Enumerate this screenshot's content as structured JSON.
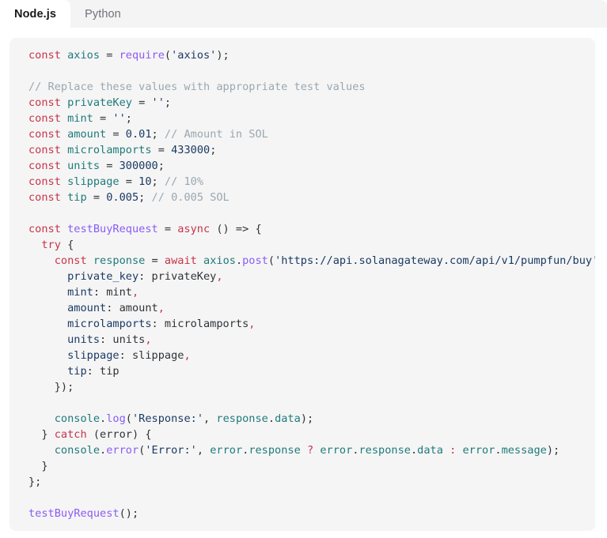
{
  "tabs": [
    {
      "id": "nodejs",
      "label": "Node.js",
      "active": true
    },
    {
      "id": "python",
      "label": "Python",
      "active": false
    }
  ],
  "colors": {
    "tabbar_bg": "#f4f4f5",
    "tab_active_bg": "#ffffff",
    "tab_active_text": "#18181b",
    "tab_inactive_text": "#71717a",
    "code_bg": "#f5f5f5",
    "keyword": "#c7344a",
    "identifier": "#1f7a7a",
    "function": "#8a5cf6",
    "string": "#1b3a63",
    "number": "#1b3a63",
    "comment": "#9aa7b0",
    "plain": "#2f3337"
  },
  "code": {
    "language": "javascript",
    "lines": [
      [
        {
          "t": "const",
          "c": "keyword"
        },
        {
          "t": " ",
          "c": "plain"
        },
        {
          "t": "axios",
          "c": "ident"
        },
        {
          "t": " = ",
          "c": "op"
        },
        {
          "t": "require",
          "c": "func"
        },
        {
          "t": "(",
          "c": "punct"
        },
        {
          "t": "'axios'",
          "c": "string"
        },
        {
          "t": ");",
          "c": "punct"
        }
      ],
      [],
      [
        {
          "t": "// Replace these values with appropriate test values",
          "c": "comment"
        }
      ],
      [
        {
          "t": "const",
          "c": "keyword"
        },
        {
          "t": " ",
          "c": "plain"
        },
        {
          "t": "privateKey",
          "c": "ident"
        },
        {
          "t": " = ",
          "c": "op"
        },
        {
          "t": "''",
          "c": "string"
        },
        {
          "t": ";",
          "c": "punct"
        }
      ],
      [
        {
          "t": "const",
          "c": "keyword"
        },
        {
          "t": " ",
          "c": "plain"
        },
        {
          "t": "mint",
          "c": "ident"
        },
        {
          "t": " = ",
          "c": "op"
        },
        {
          "t": "''",
          "c": "string"
        },
        {
          "t": ";",
          "c": "punct"
        }
      ],
      [
        {
          "t": "const",
          "c": "keyword"
        },
        {
          "t": " ",
          "c": "plain"
        },
        {
          "t": "amount",
          "c": "ident"
        },
        {
          "t": " = ",
          "c": "op"
        },
        {
          "t": "0.01",
          "c": "number"
        },
        {
          "t": "; ",
          "c": "punct"
        },
        {
          "t": "// Amount in SOL",
          "c": "comment"
        }
      ],
      [
        {
          "t": "const",
          "c": "keyword"
        },
        {
          "t": " ",
          "c": "plain"
        },
        {
          "t": "microlamports",
          "c": "ident"
        },
        {
          "t": " = ",
          "c": "op"
        },
        {
          "t": "433000",
          "c": "number"
        },
        {
          "t": ";",
          "c": "punct"
        }
      ],
      [
        {
          "t": "const",
          "c": "keyword"
        },
        {
          "t": " ",
          "c": "plain"
        },
        {
          "t": "units",
          "c": "ident"
        },
        {
          "t": " = ",
          "c": "op"
        },
        {
          "t": "300000",
          "c": "number"
        },
        {
          "t": ";",
          "c": "punct"
        }
      ],
      [
        {
          "t": "const",
          "c": "keyword"
        },
        {
          "t": " ",
          "c": "plain"
        },
        {
          "t": "slippage",
          "c": "ident"
        },
        {
          "t": " = ",
          "c": "op"
        },
        {
          "t": "10",
          "c": "number"
        },
        {
          "t": "; ",
          "c": "punct"
        },
        {
          "t": "// 10%",
          "c": "comment"
        }
      ],
      [
        {
          "t": "const",
          "c": "keyword"
        },
        {
          "t": " ",
          "c": "plain"
        },
        {
          "t": "tip",
          "c": "ident"
        },
        {
          "t": " = ",
          "c": "op"
        },
        {
          "t": "0.005",
          "c": "number"
        },
        {
          "t": "; ",
          "c": "punct"
        },
        {
          "t": "// 0.005 SOL",
          "c": "comment"
        }
      ],
      [],
      [
        {
          "t": "const",
          "c": "keyword"
        },
        {
          "t": " ",
          "c": "plain"
        },
        {
          "t": "testBuyRequest",
          "c": "func"
        },
        {
          "t": " = ",
          "c": "op"
        },
        {
          "t": "async",
          "c": "keyword"
        },
        {
          "t": " () ",
          "c": "punct"
        },
        {
          "t": "=>",
          "c": "op"
        },
        {
          "t": " {",
          "c": "punct"
        }
      ],
      [
        {
          "t": "  ",
          "c": "plain"
        },
        {
          "t": "try",
          "c": "keyword"
        },
        {
          "t": " {",
          "c": "punct"
        }
      ],
      [
        {
          "t": "    ",
          "c": "plain"
        },
        {
          "t": "const",
          "c": "keyword"
        },
        {
          "t": " ",
          "c": "plain"
        },
        {
          "t": "response",
          "c": "ident"
        },
        {
          "t": " = ",
          "c": "op"
        },
        {
          "t": "await",
          "c": "keyword"
        },
        {
          "t": " ",
          "c": "plain"
        },
        {
          "t": "axios",
          "c": "ident"
        },
        {
          "t": ".",
          "c": "punct"
        },
        {
          "t": "post",
          "c": "func"
        },
        {
          "t": "(",
          "c": "punct"
        },
        {
          "t": "'https://api.solanagateway.com/api/v1/pumpfun/buy'",
          "c": "string"
        },
        {
          "t": ", {",
          "c": "punct"
        }
      ],
      [
        {
          "t": "      ",
          "c": "plain"
        },
        {
          "t": "private_key",
          "c": "prop"
        },
        {
          "t": ": ",
          "c": "punct"
        },
        {
          "t": "privateKey",
          "c": "plain"
        },
        {
          "t": ",",
          "c": "keyword"
        }
      ],
      [
        {
          "t": "      ",
          "c": "plain"
        },
        {
          "t": "mint",
          "c": "prop"
        },
        {
          "t": ": ",
          "c": "punct"
        },
        {
          "t": "mint",
          "c": "plain"
        },
        {
          "t": ",",
          "c": "keyword"
        }
      ],
      [
        {
          "t": "      ",
          "c": "plain"
        },
        {
          "t": "amount",
          "c": "prop"
        },
        {
          "t": ": ",
          "c": "punct"
        },
        {
          "t": "amount",
          "c": "plain"
        },
        {
          "t": ",",
          "c": "keyword"
        }
      ],
      [
        {
          "t": "      ",
          "c": "plain"
        },
        {
          "t": "microlamports",
          "c": "prop"
        },
        {
          "t": ": ",
          "c": "punct"
        },
        {
          "t": "microlamports",
          "c": "plain"
        },
        {
          "t": ",",
          "c": "keyword"
        }
      ],
      [
        {
          "t": "      ",
          "c": "plain"
        },
        {
          "t": "units",
          "c": "prop"
        },
        {
          "t": ": ",
          "c": "punct"
        },
        {
          "t": "units",
          "c": "plain"
        },
        {
          "t": ",",
          "c": "keyword"
        }
      ],
      [
        {
          "t": "      ",
          "c": "plain"
        },
        {
          "t": "slippage",
          "c": "prop"
        },
        {
          "t": ": ",
          "c": "punct"
        },
        {
          "t": "slippage",
          "c": "plain"
        },
        {
          "t": ",",
          "c": "keyword"
        }
      ],
      [
        {
          "t": "      ",
          "c": "plain"
        },
        {
          "t": "tip",
          "c": "prop"
        },
        {
          "t": ": ",
          "c": "punct"
        },
        {
          "t": "tip",
          "c": "plain"
        }
      ],
      [
        {
          "t": "    });",
          "c": "punct"
        }
      ],
      [],
      [
        {
          "t": "    ",
          "c": "plain"
        },
        {
          "t": "console",
          "c": "ident"
        },
        {
          "t": ".",
          "c": "punct"
        },
        {
          "t": "log",
          "c": "func"
        },
        {
          "t": "(",
          "c": "punct"
        },
        {
          "t": "'Response:'",
          "c": "string"
        },
        {
          "t": ", ",
          "c": "punct"
        },
        {
          "t": "response",
          "c": "ident"
        },
        {
          "t": ".",
          "c": "punct"
        },
        {
          "t": "data",
          "c": "ident"
        },
        {
          "t": ");",
          "c": "punct"
        }
      ],
      [
        {
          "t": "  } ",
          "c": "punct"
        },
        {
          "t": "catch",
          "c": "keyword"
        },
        {
          "t": " (",
          "c": "punct"
        },
        {
          "t": "error",
          "c": "plain"
        },
        {
          "t": ") {",
          "c": "punct"
        }
      ],
      [
        {
          "t": "    ",
          "c": "plain"
        },
        {
          "t": "console",
          "c": "ident"
        },
        {
          "t": ".",
          "c": "punct"
        },
        {
          "t": "error",
          "c": "func"
        },
        {
          "t": "(",
          "c": "punct"
        },
        {
          "t": "'Error:'",
          "c": "string"
        },
        {
          "t": ", ",
          "c": "punct"
        },
        {
          "t": "error",
          "c": "ident"
        },
        {
          "t": ".",
          "c": "punct"
        },
        {
          "t": "response",
          "c": "ident"
        },
        {
          "t": " ",
          "c": "plain"
        },
        {
          "t": "?",
          "c": "keyword"
        },
        {
          "t": " ",
          "c": "plain"
        },
        {
          "t": "error",
          "c": "ident"
        },
        {
          "t": ".",
          "c": "punct"
        },
        {
          "t": "response",
          "c": "ident"
        },
        {
          "t": ".",
          "c": "punct"
        },
        {
          "t": "data",
          "c": "ident"
        },
        {
          "t": " ",
          "c": "plain"
        },
        {
          "t": ":",
          "c": "keyword"
        },
        {
          "t": " ",
          "c": "plain"
        },
        {
          "t": "error",
          "c": "ident"
        },
        {
          "t": ".",
          "c": "punct"
        },
        {
          "t": "message",
          "c": "ident"
        },
        {
          "t": ");",
          "c": "punct"
        }
      ],
      [
        {
          "t": "  }",
          "c": "punct"
        }
      ],
      [
        {
          "t": "};",
          "c": "punct"
        }
      ],
      [],
      [
        {
          "t": "testBuyRequest",
          "c": "func"
        },
        {
          "t": "();",
          "c": "punct"
        }
      ]
    ]
  }
}
